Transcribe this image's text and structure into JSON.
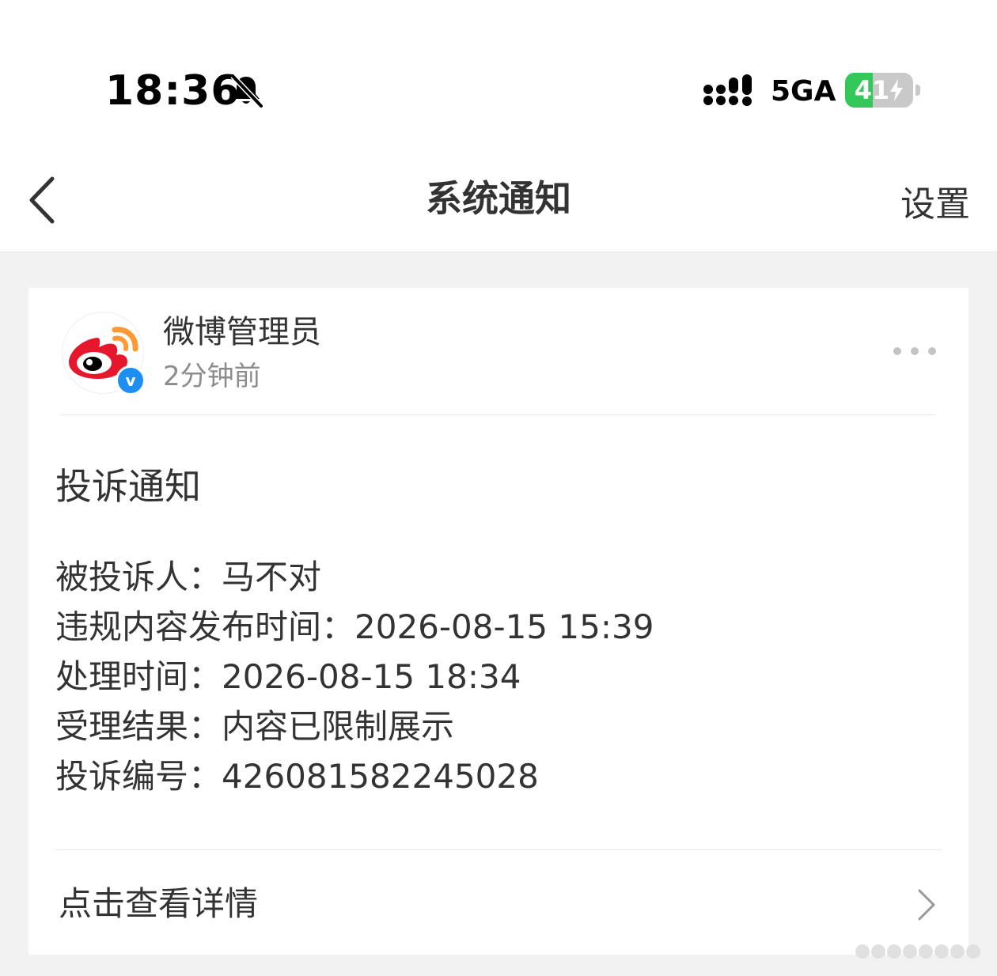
{
  "status_bar": {
    "time": "18:36",
    "network": "5GA",
    "battery_percent": 41,
    "battery_label": "41",
    "mute_icon": "bell-slash-icon",
    "signal_icon": "cellular-signal-icon",
    "charging_icon": "bolt-icon"
  },
  "nav": {
    "title": "系统通知",
    "settings_label": "设置",
    "back_icon": "chevron-left-icon"
  },
  "message": {
    "sender": "微博管理员",
    "time_ago": "2分钟前",
    "avatar_icon": "weibo-logo-icon",
    "verified_label": "v",
    "more_icon": "more-dots-icon",
    "title": "投诉通知",
    "details": [
      "被投诉人：马不对",
      "违规内容发布时间：2026-08-15 15:39",
      "处理时间：2026-08-15 18:34",
      "受理结果：内容已限制展示",
      "投诉编号：426081582245028"
    ],
    "link_label": "点击查看详情",
    "link_icon": "chevron-right-icon"
  },
  "colors": {
    "background": "#f2f2f2",
    "card": "#ffffff",
    "text_primary": "#333333",
    "text_secondary": "#8c8c8c",
    "verified_blue": "#1d8ff2",
    "battery_green": "#34c759",
    "weibo_red": "#e6162d",
    "weibo_orange": "#ff9933"
  }
}
